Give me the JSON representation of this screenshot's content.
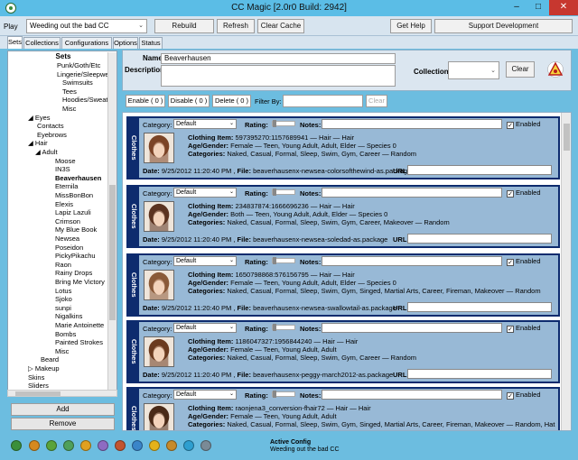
{
  "window": {
    "title": "CC Magic [2.0r0 Build: 2942]",
    "min_glyph": "–",
    "max_glyph": "□",
    "close_glyph": "✕"
  },
  "toolbar": {
    "play_label": "Play",
    "config_value": "Weeding out the bad CC",
    "rebuild_label": "Rebuild",
    "refresh_label": "Refresh",
    "clear_cache_label": "Clear Cache",
    "get_help_label": "Get Help",
    "support_label": "Support Development"
  },
  "tabs": [
    "Sets",
    "Collections",
    "Configurations",
    "Options",
    "Status"
  ],
  "sidebar": {
    "header": "Sets",
    "items": [
      "Punk/Goth/Etc",
      "Lingerie/Sleepwear",
      "Swimsuits",
      "Tees",
      "Hoodies/Sweaters",
      "Misc",
      "◢ Eyes",
      "Contacts",
      "Eyebrows",
      "◢ Hair",
      "◢ Adult",
      "Moose",
      "IN3S",
      "Beaverhausen",
      "Eternila",
      "MissBonBon",
      "Elexis",
      "Lapiz Lazuli",
      "Crimson",
      "My Blue Book",
      "Newsea",
      "Poseidon",
      "PickyPikachu",
      "Raon",
      "Rainy Drops",
      "Bring Me Victory",
      "Lotus",
      "Sjoko",
      "sunpi",
      "Nigalkins",
      "Marie Antoinette",
      "Bombs",
      "Painted Strokes",
      "Misc",
      "Beard",
      "▷ Makeup",
      "Skins",
      "Sliders",
      "Tattoos"
    ],
    "add_label": "Add",
    "remove_label": "Remove"
  },
  "detail": {
    "name_label": "Name",
    "name_value": "Beaverhausen",
    "description_label": "Description",
    "collection_label": "Collection",
    "clear_label": "Clear"
  },
  "filter": {
    "enable_label": "Enable ( 0 )",
    "disable_label": "Disable ( 0 )",
    "delete_label": "Delete ( 0 )",
    "filter_by_label": "Filter By:",
    "clear_label": "Clear"
  },
  "card_labels": {
    "type": "Clothes",
    "category": "Category:",
    "category_value": "Default",
    "rating": "Rating:",
    "notes": "Notes:",
    "enabled": "Enabled",
    "clothing_item": "Clothing Item:",
    "age_gender": "Age/Gender:",
    "categories": "Categories:",
    "date": "Date:",
    "file": "File:",
    "url": "URL:"
  },
  "cards": [
    {
      "item": "597395270:1157689941 — Hair — Hair",
      "age_gender": "Female — Teen, Young Adult, Adult, Elder — Species 0",
      "categories": "Naked, Casual, Formal, Sleep, Swim, Gym, Career — Random",
      "date": "9/25/2012 11:20:40 PM",
      "file": "beaverhausenx-newsea-colorsofthewind-as.package"
    },
    {
      "item": "234837874:1666696236 — Hair — Hair",
      "age_gender": "Both — Teen, Young Adult, Adult, Elder — Species 0",
      "categories": "Naked, Casual, Formal, Sleep, Swim, Gym, Career, Makeover — Random",
      "date": "9/25/2012 11:20:40 PM",
      "file": "beaverhausenx-newsea-soledad-as.package"
    },
    {
      "item": "1650798868:576156795 — Hair — Hair",
      "age_gender": "Female — Teen, Young Adult, Adult, Elder — Species 0",
      "categories": "Naked, Casual, Formal, Sleep, Swim, Gym, Singed, Martial Arts, Career, Fireman, Makeover — Random",
      "date": "9/25/2012 11:20:40 PM",
      "file": "beaverhausenx-newsea-swallowtail-as.package"
    },
    {
      "item": "1186047327:1956844240 — Hair — Hair",
      "age_gender": "Female — Teen, Young Adult, Adult",
      "categories": "Naked, Casual, Formal, Sleep, Swim, Gym, Career — Random",
      "date": "9/25/2012 11:20:40 PM",
      "file": "beaverhausenx-peggy-march2012-as.package"
    },
    {
      "item": "raonjena3_conversion-fhair72 — Hair — Hair",
      "age_gender": "Female — Teen, Young Adult, Adult",
      "categories": "Naked, Casual, Formal, Sleep, Swim, Gym, Singed, Martial Arts, Career, Fireman, Makeover — Random, Hat",
      "date": "",
      "file": ""
    }
  ],
  "status": {
    "active_config_label": "Active Config",
    "active_config_value": "Weeding out the bad CC"
  },
  "taskbar_colors": [
    "#3b8f3b",
    "#d5891e",
    "#5aa33a",
    "#4fa05a",
    "#e0a020",
    "#8e6bc2",
    "#c2542f",
    "#3a85c9",
    "#e3b21a",
    "#c78a2a",
    "#2e9fd0",
    "#7a8a96"
  ]
}
